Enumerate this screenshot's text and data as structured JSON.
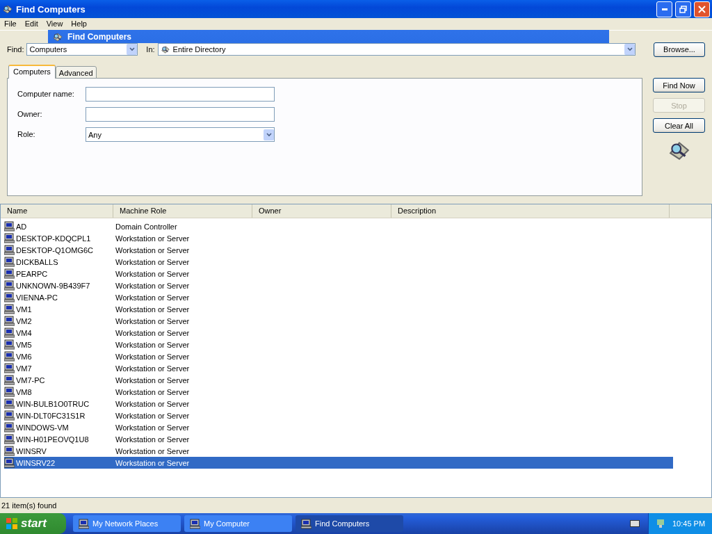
{
  "window": {
    "title": "Find Computers"
  },
  "menu": [
    "File",
    "Edit",
    "View",
    "Help"
  ],
  "drag_bar": {
    "title": "Find Computers"
  },
  "find": {
    "label": "Find:",
    "value": "Computers"
  },
  "scope": {
    "label": "In:",
    "value": "Entire Directory"
  },
  "browse_button": "Browse...",
  "tabs": [
    {
      "label": "Computers",
      "selected": true
    },
    {
      "label": "Advanced",
      "selected": false
    }
  ],
  "form": [
    {
      "kind": "text",
      "label": "Computer name:"
    },
    {
      "kind": "text",
      "label": "Owner:"
    },
    {
      "kind": "select",
      "label": "Role:",
      "value": "Any"
    }
  ],
  "actions": [
    {
      "label": "Find Now",
      "disabled": false
    },
    {
      "label": "Stop",
      "disabled": true
    },
    {
      "label": "Clear All",
      "disabled": false
    }
  ],
  "table": {
    "columns": [
      "Name",
      "Machine Role",
      "Owner",
      "Description"
    ],
    "rows": [
      {
        "name": "AD",
        "role": "Domain Controller",
        "selected": false
      },
      {
        "name": "DESKTOP-KDQCPL1",
        "role": "Workstation or Server",
        "selected": false
      },
      {
        "name": "DESKTOP-Q1OMG6C",
        "role": "Workstation or Server",
        "selected": false
      },
      {
        "name": "DICKBALLS",
        "role": "Workstation or Server",
        "selected": false
      },
      {
        "name": "PEARPC",
        "role": "Workstation or Server",
        "selected": false
      },
      {
        "name": "UNKNOWN-9B439F7",
        "role": "Workstation or Server",
        "selected": false
      },
      {
        "name": "VIENNA-PC",
        "role": "Workstation or Server",
        "selected": false
      },
      {
        "name": "VM1",
        "role": "Workstation or Server",
        "selected": false
      },
      {
        "name": "VM2",
        "role": "Workstation or Server",
        "selected": false
      },
      {
        "name": "VM4",
        "role": "Workstation or Server",
        "selected": false
      },
      {
        "name": "VM5",
        "role": "Workstation or Server",
        "selected": false
      },
      {
        "name": "VM6",
        "role": "Workstation or Server",
        "selected": false
      },
      {
        "name": "VM7",
        "role": "Workstation or Server",
        "selected": false
      },
      {
        "name": "VM7-PC",
        "role": "Workstation or Server",
        "selected": false
      },
      {
        "name": "VM8",
        "role": "Workstation or Server",
        "selected": false
      },
      {
        "name": "WIN-BULB1O0TRUC",
        "role": "Workstation or Server",
        "selected": false
      },
      {
        "name": "WIN-DLT0FC31S1R",
        "role": "Workstation or Server",
        "selected": false
      },
      {
        "name": "WINDOWS-VM",
        "role": "Workstation or Server",
        "selected": false
      },
      {
        "name": "WIN-H01PEOVQ1U8",
        "role": "Workstation or Server",
        "selected": false
      },
      {
        "name": "WINSRV",
        "role": "Workstation or Server",
        "selected": false
      },
      {
        "name": "WINSRV22",
        "role": "Workstation or Server",
        "selected": true
      }
    ]
  },
  "status_bar": "21 item(s) found",
  "taskbar": {
    "start": "start",
    "tasks": [
      {
        "label": "My Network Places",
        "selected": false
      },
      {
        "label": "My Computer",
        "selected": false
      },
      {
        "label": "Find Computers",
        "selected": true
      }
    ],
    "clock": "10:45 PM"
  }
}
